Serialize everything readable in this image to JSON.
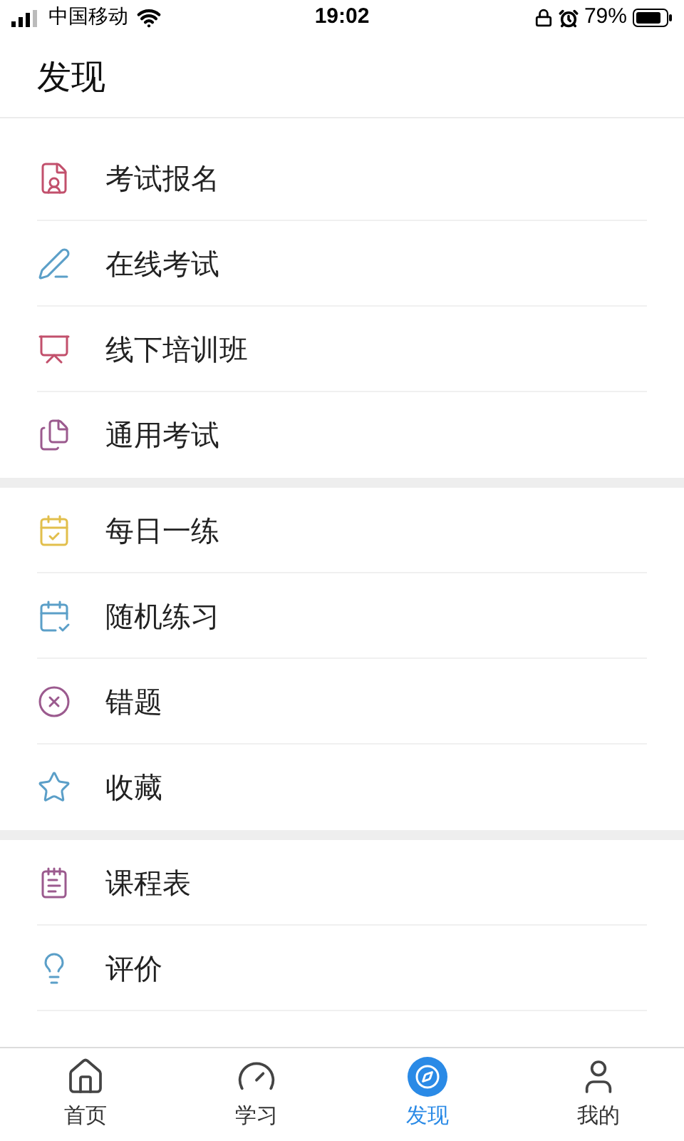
{
  "status_bar": {
    "carrier": "中国移动",
    "time": "19:02",
    "battery": "79%"
  },
  "header": {
    "title": "发现"
  },
  "sections": [
    {
      "items": [
        {
          "label": "考试报名"
        },
        {
          "label": "在线考试"
        },
        {
          "label": "线下培训班"
        },
        {
          "label": "通用考试"
        }
      ]
    },
    {
      "items": [
        {
          "label": "每日一练"
        },
        {
          "label": "随机练习"
        },
        {
          "label": "错题"
        },
        {
          "label": "收藏"
        }
      ]
    },
    {
      "items": [
        {
          "label": "课程表"
        },
        {
          "label": "评价"
        }
      ]
    }
  ],
  "tab_bar": [
    {
      "label": "首页",
      "selected": false
    },
    {
      "label": "学习",
      "selected": false
    },
    {
      "label": "发现",
      "selected": true
    },
    {
      "label": "我的",
      "selected": false
    }
  ]
}
